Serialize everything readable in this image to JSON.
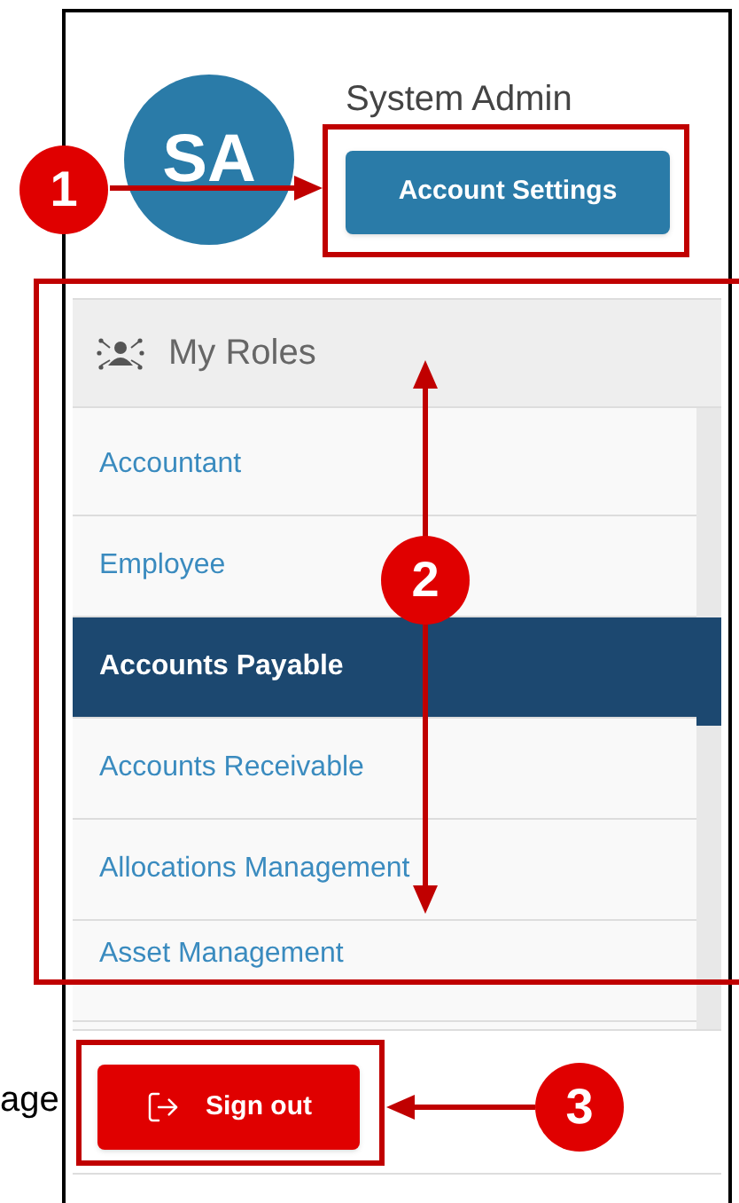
{
  "background_text": "age",
  "profile": {
    "initials": "SA",
    "name": "System Admin",
    "button": "Account Settings"
  },
  "roles": {
    "title": "My Roles",
    "items": [
      {
        "label": "Accountant",
        "selected": false
      },
      {
        "label": "Employee",
        "selected": false
      },
      {
        "label": "Accounts Payable",
        "selected": true
      },
      {
        "label": "Accounts Receivable",
        "selected": false
      },
      {
        "label": "Allocations Management",
        "selected": false
      },
      {
        "label": "Asset Management",
        "selected": false
      }
    ]
  },
  "sign_out": {
    "label": "Sign out"
  },
  "annotations": [
    {
      "number": "1"
    },
    {
      "number": "2"
    },
    {
      "number": "3"
    }
  ]
}
